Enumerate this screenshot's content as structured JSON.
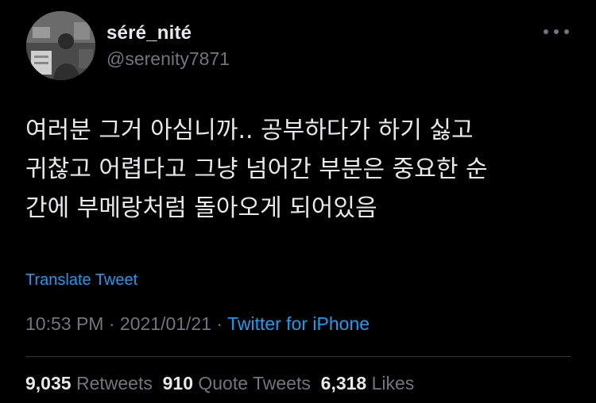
{
  "user": {
    "display_name": "séré_nité",
    "handle": "@serenity7871",
    "avatar_icon": "profile-photo"
  },
  "tweet": {
    "lines": [
      "여러분 그거 아심니까.. 공부하다가 하기 싫고",
      "귀찮고 어렵다고 그냥 넘어간 부분은 중요한 순",
      "간에 부메랑처럼 돌아오게 되어있음"
    ],
    "translate_label": "Translate Tweet"
  },
  "meta": {
    "time": "10:53 PM",
    "separator": " · ",
    "date": "2021/01/21",
    "source": "Twitter for iPhone"
  },
  "stats": {
    "retweets_count": "9,035",
    "retweets_label": "Retweets",
    "quote_count": "910",
    "quote_label": "Quote Tweets",
    "likes_count": "6,318",
    "likes_label": "Likes"
  },
  "colors": {
    "background": "#000000",
    "text": "#e7e9ea",
    "secondary": "#71767b",
    "link": "#1d9bf0"
  }
}
